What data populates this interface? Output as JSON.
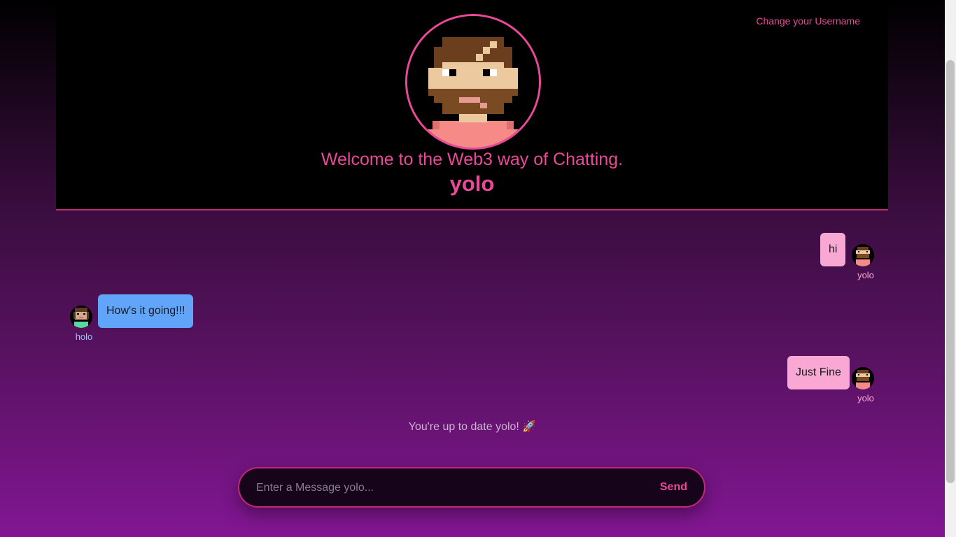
{
  "header": {
    "change_username_label": "Change your Username",
    "welcome_text": "Welcome to the Web3 way of Chatting.",
    "current_username": "yolo"
  },
  "messages": [
    {
      "text": "hi",
      "sender": "yolo",
      "side": "right"
    },
    {
      "text": "How's it going!!!",
      "sender": "holo",
      "side": "left"
    },
    {
      "text": "Just Fine",
      "sender": "yolo",
      "side": "right"
    }
  ],
  "status": {
    "up_to_date": "You're up to date yolo! 🚀"
  },
  "composer": {
    "placeholder": "Enter a Message yolo...",
    "send_label": "Send"
  },
  "colors": {
    "accent": "#ec4899",
    "own_bubble": "#f9a8d4",
    "other_bubble": "#60a5fa"
  }
}
